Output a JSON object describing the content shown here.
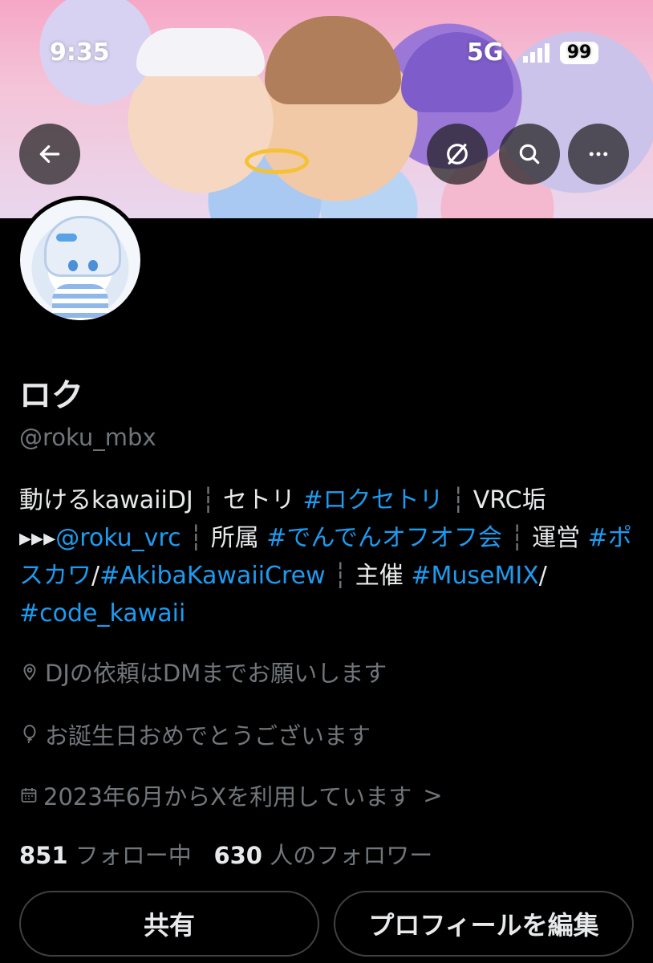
{
  "status_bar": {
    "time": "9:35",
    "network": "5G",
    "battery": "99"
  },
  "profile": {
    "name": "ロク",
    "handle": "@roku_mbx",
    "bio": [
      {
        "t": "動けるkawaiiDJ",
        "k": "text"
      },
      {
        "t": " ┆ ",
        "k": "sep"
      },
      {
        "t": "セトリ ",
        "k": "text"
      },
      {
        "t": "#ロクセトリ",
        "k": "link"
      },
      {
        "t": " ┆ ",
        "k": "sep"
      },
      {
        "t": "VRC垢 ▸▸▸",
        "k": "text"
      },
      {
        "t": "@roku_vrc",
        "k": "link"
      },
      {
        "t": " ┆ ",
        "k": "sep"
      },
      {
        "t": "所属 ",
        "k": "text"
      },
      {
        "t": "#でんでんオフオフ会",
        "k": "link"
      },
      {
        "t": " ┆ ",
        "k": "sep"
      },
      {
        "t": "運営 ",
        "k": "text"
      },
      {
        "t": "#ポスカワ",
        "k": "link"
      },
      {
        "t": "/",
        "k": "text"
      },
      {
        "t": "#AkibaKawaiiCrew",
        "k": "link"
      },
      {
        "t": " ┆ ",
        "k": "sep"
      },
      {
        "t": "主催 ",
        "k": "text"
      },
      {
        "t": "#MuseMIX",
        "k": "link"
      },
      {
        "t": "/ ",
        "k": "text"
      },
      {
        "t": "#code_kawaii",
        "k": "link"
      }
    ],
    "location": "DJの依頼はDMまでお願いします",
    "birthday": "お誕生日おめでとうございます",
    "joined": "2023年6月からXを利用しています",
    "joined_chevron": ">",
    "following_count": "851",
    "following_label": "フォロー中",
    "followers_count": "630",
    "followers_label": "人のフォロワー"
  },
  "buttons": {
    "share": "共有",
    "edit_profile": "プロフィールを編集"
  },
  "icons": {
    "back": "arrow-left-icon",
    "grok": "slash-circle-icon",
    "search": "search-icon",
    "more": "more-icon",
    "location": "location-pin-icon",
    "birthday": "balloon-icon",
    "calendar": "calendar-icon"
  },
  "colors": {
    "link": "#1d9bf0",
    "muted": "#71767b",
    "text": "#e7e9ea",
    "background": "#000000"
  }
}
